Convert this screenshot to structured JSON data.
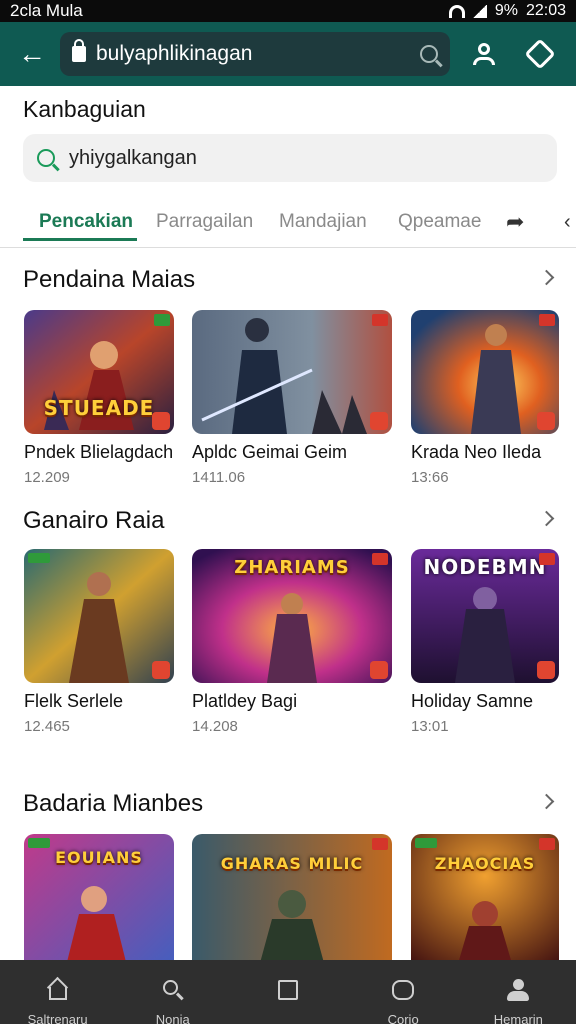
{
  "status_bar": {
    "left_text": "2cla Mula",
    "battery_text": "9%",
    "time": "22:03"
  },
  "browser": {
    "url": "bulyaphlikinagan"
  },
  "page": {
    "title": "Kanbaguian",
    "search_value": "yhiygalkangan",
    "tabs": [
      {
        "label": "Pencakian"
      },
      {
        "label": "Parragailan"
      },
      {
        "label": "Mandajian"
      },
      {
        "label": "Qpeamae"
      }
    ]
  },
  "sections": [
    {
      "title": "Pendaina Maias",
      "cards": [
        {
          "title": "Pndek Blielagdach",
          "meta": "12.209",
          "caption": "STUEADE"
        },
        {
          "title": "Apldc Geimai Geim",
          "meta": "1411.06",
          "caption": ""
        },
        {
          "title": "Krada Neo Ileda",
          "meta": "13:66",
          "caption": ""
        }
      ]
    },
    {
      "title": "Ganairo Raia",
      "cards": [
        {
          "title": "Flelk Serlele",
          "meta": "12.465",
          "caption": ""
        },
        {
          "title": "Platldey Bagi",
          "meta": "14.208",
          "caption": "ZHARIAMS"
        },
        {
          "title": "Holiday Samne",
          "meta": "13:01",
          "caption": "NODEBMN"
        }
      ]
    },
    {
      "title": "Badaria Mianbes",
      "cards": [
        {
          "title": "",
          "meta": "",
          "caption": "EOUIANS"
        },
        {
          "title": "",
          "meta": "",
          "caption": "GHARAS MILIC"
        },
        {
          "title": "",
          "meta": "",
          "caption": "ZHAOCIAS"
        }
      ]
    }
  ],
  "bottom_nav": [
    {
      "label": "Saltrenaru",
      "icon": "home-icon"
    },
    {
      "label": "Nonia",
      "icon": "search-icon"
    },
    {
      "label": "",
      "icon": "square-icon"
    },
    {
      "label": "Corio",
      "icon": "chat-icon"
    },
    {
      "label": "Hemarin",
      "icon": "profile-icon"
    }
  ],
  "colors": {
    "appbar": "#0f5a52",
    "accent": "#1b7a55",
    "nav_bg": "#2f2f2f"
  }
}
